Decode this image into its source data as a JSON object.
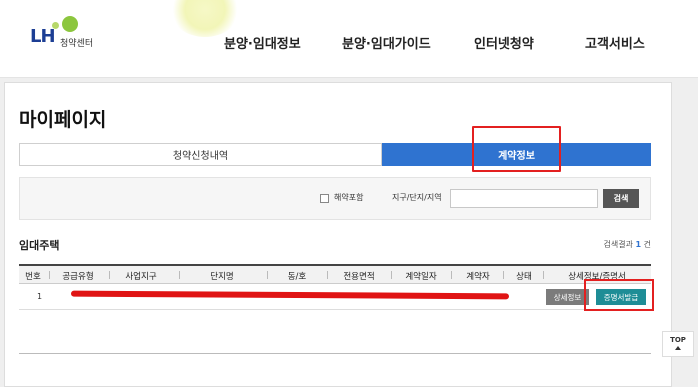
{
  "header": {
    "logo_text": "LH",
    "logo_sub": "청약센터",
    "nav": [
      "분양·임대정보",
      "분양·임대가이드",
      "인터넷청약",
      "고객서비스"
    ]
  },
  "page": {
    "title": "마이페이지"
  },
  "tabs": [
    {
      "label": "청약신청내역",
      "active": false
    },
    {
      "label": "계약정보",
      "active": true
    }
  ],
  "search": {
    "checkbox_label": "해약포함",
    "checkbox_checked": false,
    "field_label": "지구/단지/지역",
    "input_value": "",
    "button_label": "검색"
  },
  "section": {
    "title": "임대주택",
    "result_prefix": "검색결과",
    "result_count": "1",
    "result_suffix": "건"
  },
  "table": {
    "headers": [
      "번호",
      "공급유형",
      "사업지구",
      "단지명",
      "동/호",
      "전용면적",
      "계약일자",
      "계약자",
      "상태",
      "상세정보/증명서"
    ],
    "rows": [
      {
        "no": "1",
        "detail_button": "상세정보",
        "cert_button": "증명서발급"
      }
    ]
  },
  "top_button": {
    "label": "TOP"
  },
  "colors": {
    "accent": "#2f73d0",
    "highlight": "#e32020",
    "cert_button": "#1e8d96",
    "detail_button": "#7b7b7b"
  }
}
